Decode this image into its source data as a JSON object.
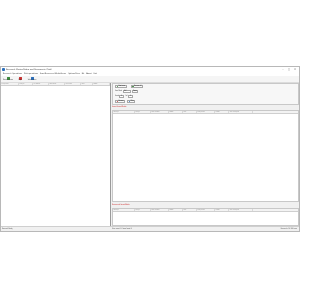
{
  "window": {
    "title": "Recoverit Photos/Video and Documents (Trial)"
  },
  "menu": [
    "Recoverit Operations",
    "Disk operations",
    "Scan/Recovered Media/Items",
    "Options/View",
    "Bit",
    "About",
    "Exit"
  ],
  "toolbar": [
    {
      "label": "Recover Items",
      "icon": "recover-icon",
      "color": "#3a8a3a"
    },
    {
      "label": "Stop",
      "icon": "stop-icon",
      "color": "#c83232"
    },
    {
      "label": "Select Items",
      "icon": "select-icon",
      "color": "#2a6ebb"
    }
  ],
  "left_grid": {
    "columns": [
      "Drive/Folder",
      "Disk/Vol.",
      "File system",
      "Total Space",
      "Free Space",
      "Used",
      "Status"
    ]
  },
  "controls": {
    "start_scan": "Start scan",
    "recover_all": "Recover all",
    "pause": "Pause",
    "scan_label": "Scan Mode",
    "scan_value": "Full",
    "items_label": "Found",
    "items_value": "0",
    "selected_label": "Sel.",
    "selected_value": "0",
    "recover_label": "Recover",
    "filter_label": "Filter"
  },
  "found_panel": {
    "title": "Found Items/Media",
    "columns": [
      "Name/ID",
      "Size/ID",
      "Date Created",
      "Status",
      "Type",
      "Disk/Volume",
      "Cluster",
      "Hash value/Disk"
    ]
  },
  "recovered_panel": {
    "title": "Recovered Items/Media",
    "columns": [
      "Name/ID",
      "Size/ID",
      "Date Created",
      "Status",
      "Type",
      "Disk/Volume",
      "Cluster",
      "Hash value/Disk"
    ]
  },
  "status": {
    "left": "Recoverit Ready",
    "middle": "Drive count: 0 / Items found: 0",
    "right": "Recoverit v1.0 / All items"
  }
}
